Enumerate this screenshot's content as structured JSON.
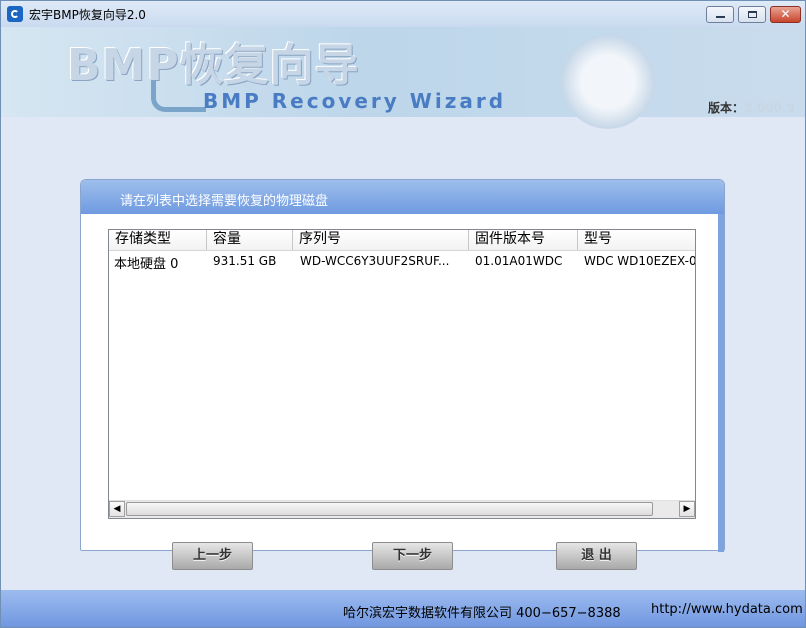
{
  "window": {
    "title": "宏宇BMP恢复向导2.0",
    "controls": {
      "minimize": "minimize-icon",
      "maximize": "maximize-icon",
      "close": "✕"
    }
  },
  "banner": {
    "title": "BMP恢复向导",
    "subtitle": "BMP Recovery Wizard",
    "version_label": "版本：",
    "version_value": "2.000.9"
  },
  "panel": {
    "header": "请在列表中选择需要恢复的物理磁盘"
  },
  "disk_list": {
    "columns": [
      "存储类型",
      "容量",
      "序列号",
      "固件版本号",
      "型号"
    ],
    "rows": [
      [
        "本地硬盘 0",
        "931.51 GB",
        "WD-WCC6Y3UUF2SRUF...",
        "01.01A01WDC",
        "WDC WD10EZEX-0"
      ]
    ],
    "scroll_left": "◀",
    "scroll_right": "▶"
  },
  "buttons": {
    "prev": "上一步",
    "next": "下一步",
    "exit": "退 出"
  },
  "footer": {
    "company": "哈尔滨宏宇数据软件有限公司  400−657−8388",
    "url": "http://www.hydata.com"
  }
}
